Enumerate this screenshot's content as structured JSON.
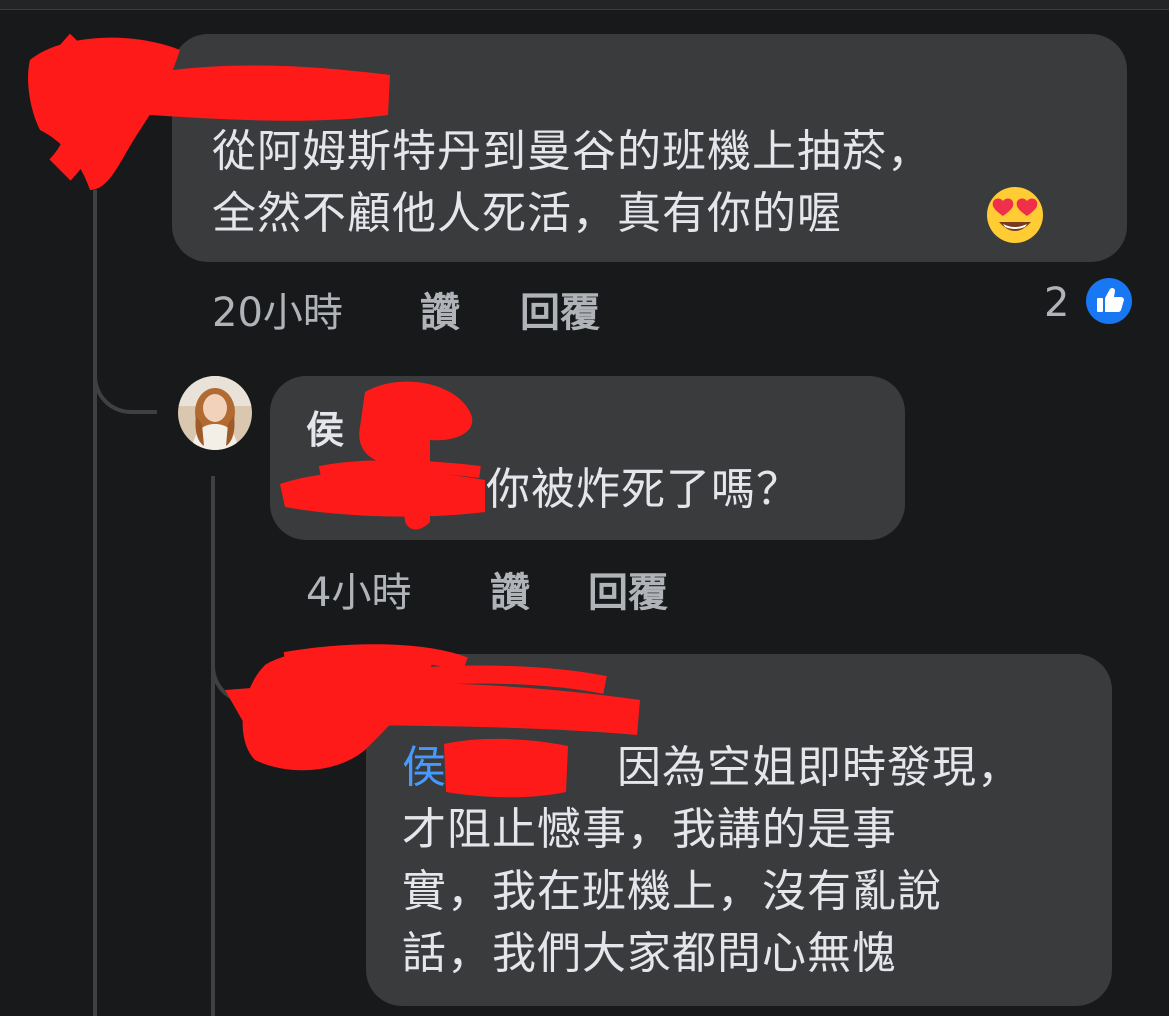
{
  "comment1": {
    "lines": [
      "從阿姆斯特丹到曼谷的班機上抽菸，",
      "全然不顧他人死活，真有你的喔"
    ],
    "emoji_icon": "heart-eyes-emoji",
    "time": "20小時",
    "like_label": "讚",
    "reply_label": "回覆",
    "reaction_count": "2",
    "reaction_icon": "like-icon"
  },
  "reply1": {
    "author_visible": "侯",
    "text": "你被炸死了嗎？",
    "time": "4小時",
    "like_label": "讚",
    "reply_label": "回覆"
  },
  "reply2": {
    "mention_visible": "侯",
    "lines": [
      "因為空姐即時發現，",
      "才阻止憾事，我講的是事",
      "實，我在班機上，沒有亂說",
      "話，我們大家都問心無愧"
    ]
  },
  "colors": {
    "background": "#18191a",
    "bubble": "#3a3b3c",
    "text": "#e4e6eb",
    "meta": "#b0b3b8",
    "mention": "#4599ff",
    "like_badge": "#1877f2",
    "redaction": "#ff1a1a"
  }
}
